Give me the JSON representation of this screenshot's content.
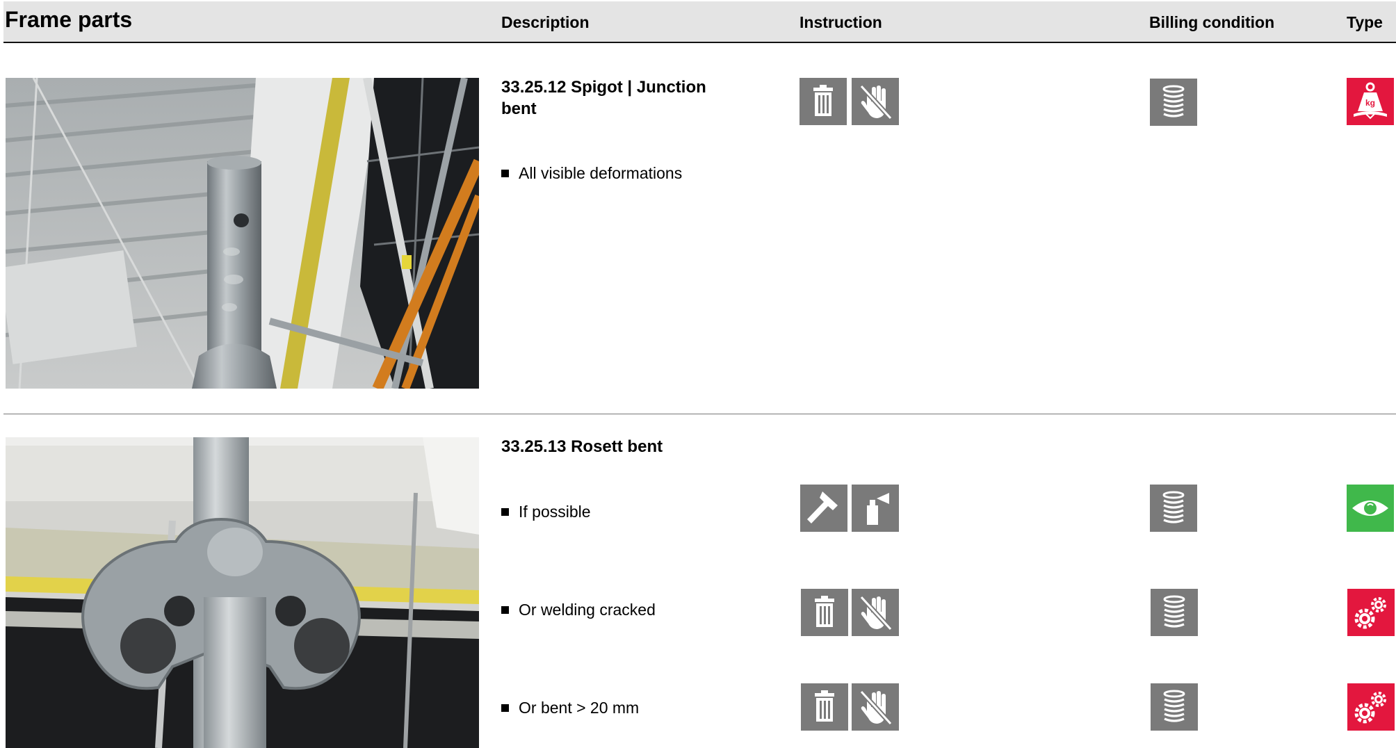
{
  "header": {
    "title": "Frame parts",
    "col_description": "Description",
    "col_instruction": "Instruction",
    "col_billing": "Billing condition",
    "col_type": "Type"
  },
  "items": [
    {
      "title": "33.25.12 Spigot | Junction bent",
      "title_line1": "33.25.12 Spigot | Junction",
      "title_line2": "bent",
      "rows": [
        {
          "text": "All visible deformations",
          "instruction_icons": [
            "trash-icon",
            "no-touch-hand-icon"
          ],
          "billing_icon": "coin-stack-icon",
          "type_icon": "weight-kg-icon",
          "type_color": "#e3173e"
        }
      ]
    },
    {
      "title": "33.25.13 Rosett bent",
      "rows": [
        {
          "text": "If possible",
          "instruction_icons": [
            "hammer-icon",
            "spray-can-icon"
          ],
          "billing_icon": "coin-stack-icon",
          "type_icon": "eye-icon",
          "type_color": "#40b84b"
        },
        {
          "text": "Or welding cracked",
          "instruction_icons": [
            "trash-icon",
            "no-touch-hand-icon"
          ],
          "billing_icon": "coin-stack-icon",
          "type_icon": "gears-icon",
          "type_color": "#e3173e"
        },
        {
          "text": "Or bent > 20 mm",
          "instruction_icons": [
            "trash-icon",
            "no-touch-hand-icon"
          ],
          "billing_icon": "coin-stack-icon",
          "type_icon": "gears-icon",
          "type_color": "#e3173e"
        }
      ]
    }
  ],
  "colors": {
    "header_bg": "#e4e4e4",
    "icon_gray": "#7a7a7a",
    "red": "#e3173e",
    "green": "#40b84b"
  }
}
